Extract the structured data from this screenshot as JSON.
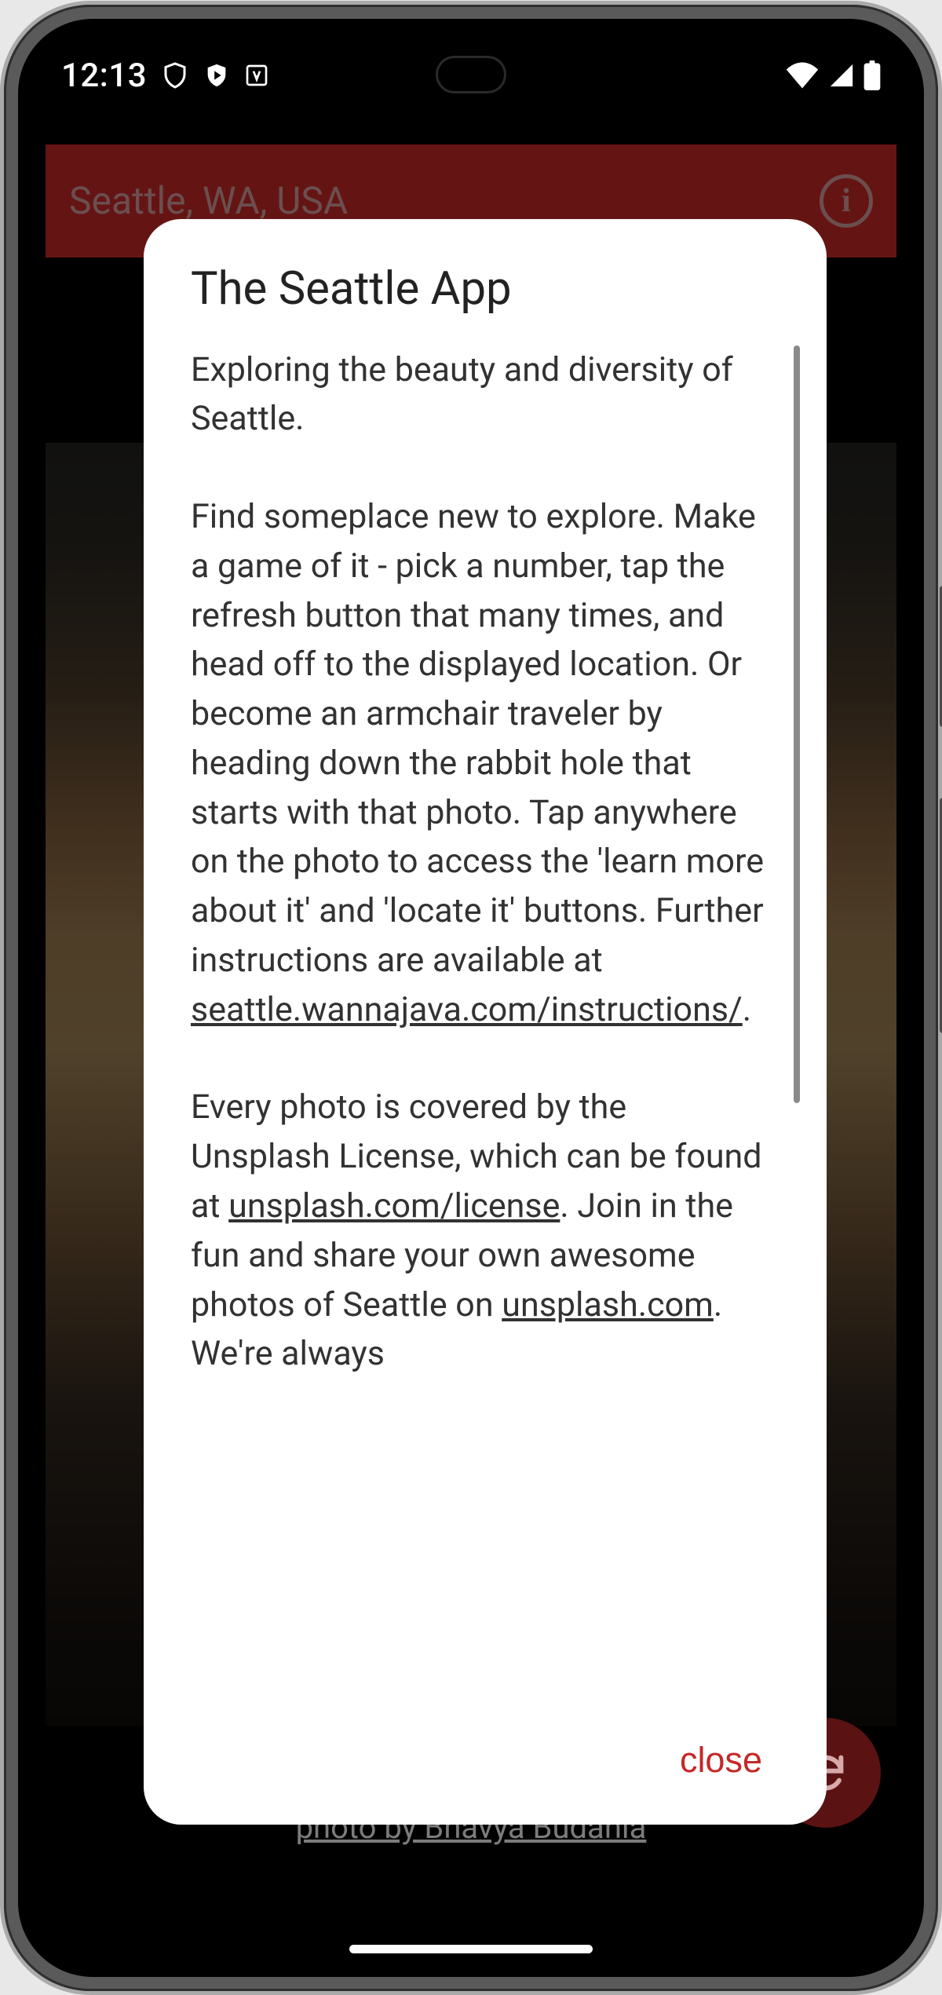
{
  "status": {
    "time": "12:13"
  },
  "app": {
    "title": "Seattle, WA, USA",
    "photo_credit": "photo by Bhavya Budania"
  },
  "dialog": {
    "title": "The Seattle App",
    "intro": "Exploring the beauty and diversity of Seattle.",
    "para1_a": "Find someplace new to explore. Make a game of it - pick a number, tap the refresh button that many times, and head off to the displayed location. Or become an armchair traveler by heading down the rabbit hole that starts with that photo. Tap anywhere on the photo to access the 'learn more about it' and 'locate it' buttons. Further instructions are available at ",
    "link1": "seattle.wannajava.com/instructions/",
    "para1_b": ".",
    "para2_a": "Every photo is covered by the Unsplash License, which can be found at ",
    "link2": "unsplash.com/license",
    "para2_b": ". Join in the fun and share your own awesome photos of Seattle on ",
    "link3": "unsplash.com",
    "para2_c": ". We're always",
    "close": "close"
  }
}
